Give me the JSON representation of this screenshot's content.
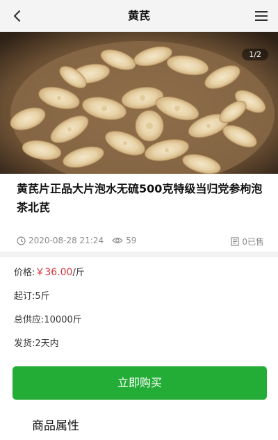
{
  "header": {
    "title": "黄芪"
  },
  "gallery": {
    "indicator": "1/2"
  },
  "product": {
    "title": "黄芪片正品大片泡水无硫500克特级当归党参枸泡茶北芪",
    "date": "2020-08-28 21:24",
    "views": "59",
    "sold": "0已售"
  },
  "details": {
    "price_label": "价格:",
    "price_value": "￥36.00",
    "price_unit": "/斤",
    "moq": "起订:5斤",
    "supply": "总供应:10000斤",
    "shipping": "发货:2天内"
  },
  "actions": {
    "buy_label": "立即购买"
  },
  "sections": {
    "attributes": "商品属性"
  },
  "colors": {
    "accent_green": "#23ad36",
    "price_red": "#d9353c"
  }
}
